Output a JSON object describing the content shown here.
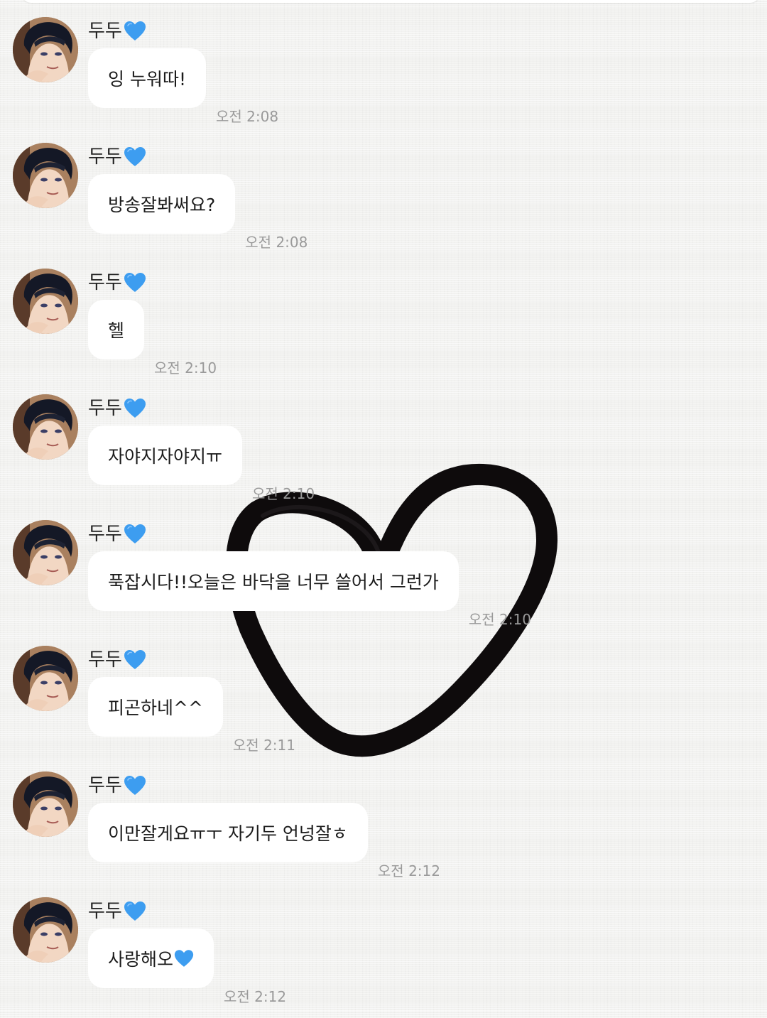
{
  "chat": {
    "messages": [
      {
        "sender": "두두",
        "sender_emoji": "blue-heart",
        "text": "잉 누워따!",
        "trailing_emoji": "",
        "time": "오전 2:08"
      },
      {
        "sender": "두두",
        "sender_emoji": "blue-heart",
        "text": "방송잘봐써요?",
        "trailing_emoji": "",
        "time": "오전 2:08"
      },
      {
        "sender": "두두",
        "sender_emoji": "blue-heart",
        "text": "헬",
        "trailing_emoji": "",
        "time": "오전 2:10"
      },
      {
        "sender": "두두",
        "sender_emoji": "blue-heart",
        "text": "자야지자야지ㅠ",
        "trailing_emoji": "",
        "time": "오전 2:10"
      },
      {
        "sender": "두두",
        "sender_emoji": "blue-heart",
        "text": "푹잡시다!!오늘은 바닥을 너무 쓸어서 그런가",
        "trailing_emoji": "",
        "time": "오전 2:10"
      },
      {
        "sender": "두두",
        "sender_emoji": "blue-heart",
        "text": "피곤하네^^",
        "trailing_emoji": "",
        "time": "오전 2:11"
      },
      {
        "sender": "두두",
        "sender_emoji": "blue-heart",
        "text": "이만잘게요ㅠㅜ 자기두 언넝잘ㅎ",
        "trailing_emoji": "",
        "time": "오전 2:12"
      },
      {
        "sender": "두두",
        "sender_emoji": "blue-heart",
        "text": "사랑해오",
        "trailing_emoji": "blue-heart",
        "time": "오전 2:12"
      }
    ]
  },
  "colors": {
    "background": "#f1f1ef",
    "bubble": "#ffffff",
    "heart_emoji": "#3d9df0",
    "timestamp": "#9a9a9a"
  },
  "icons": {
    "sender_emoji": "blue-heart-icon",
    "background_doodle": "drawn-heart-icon",
    "avatar": "profile-avatar"
  }
}
